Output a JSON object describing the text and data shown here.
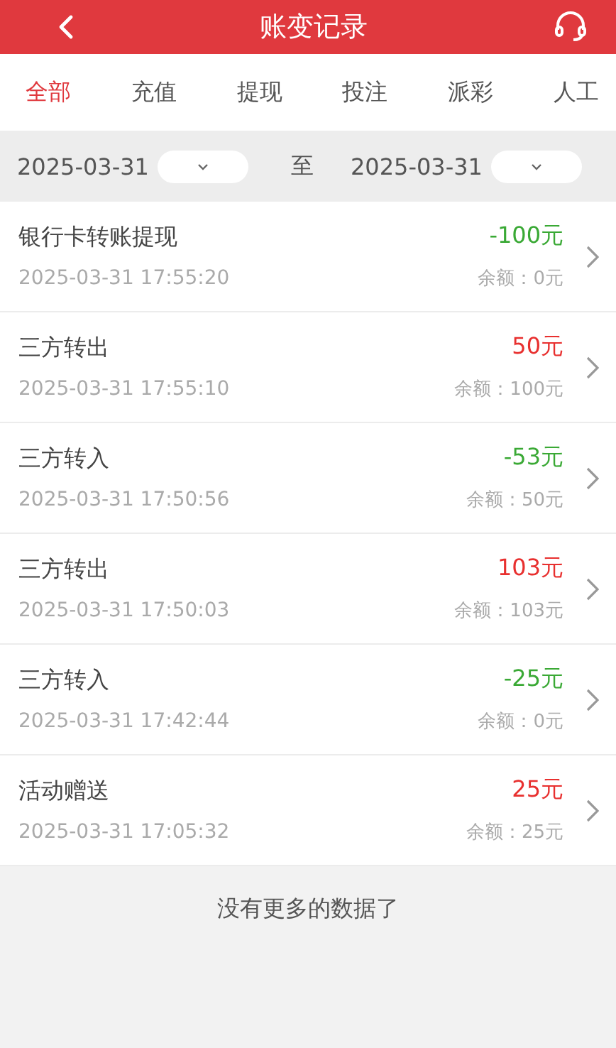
{
  "header": {
    "title": "账变记录"
  },
  "tabs": [
    {
      "label": "全部",
      "selected": true
    },
    {
      "label": "充值",
      "selected": false
    },
    {
      "label": "提现",
      "selected": false
    },
    {
      "label": "投注",
      "selected": false
    },
    {
      "label": "派彩",
      "selected": false
    },
    {
      "label": "人工",
      "selected": false
    }
  ],
  "date_filter": {
    "start": "2025-03-31",
    "separator": "至",
    "end": "2025-03-31"
  },
  "records": [
    {
      "title": "银行卡转账提现",
      "time": "2025-03-31 17:55:20",
      "amount": "-100元",
      "color": "#3aa935",
      "balance": "余额：0元"
    },
    {
      "title": "三方转出",
      "time": "2025-03-31 17:55:10",
      "amount": "50元",
      "color": "#e8302f",
      "balance": "余额：100元"
    },
    {
      "title": "三方转入",
      "time": "2025-03-31 17:50:56",
      "amount": "-53元",
      "color": "#3aa935",
      "balance": "余额：50元"
    },
    {
      "title": "三方转出",
      "time": "2025-03-31 17:50:03",
      "amount": "103元",
      "color": "#e8302f",
      "balance": "余额：103元"
    },
    {
      "title": "三方转入",
      "time": "2025-03-31 17:42:44",
      "amount": "-25元",
      "color": "#3aa935",
      "balance": "余额：0元"
    },
    {
      "title": "活动赠送",
      "time": "2025-03-31 17:05:32",
      "amount": "25元",
      "color": "#e8302f",
      "balance": "余额：25元"
    }
  ],
  "footer": "没有更多的数据了"
}
